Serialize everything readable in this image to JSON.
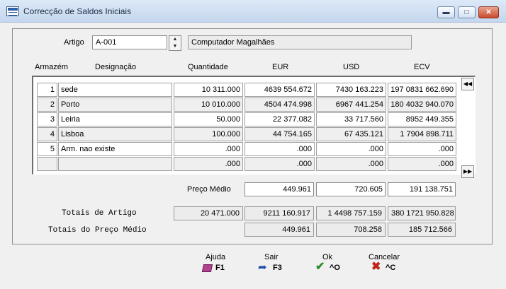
{
  "window": {
    "title": "Correcção de Saldos Iniciais"
  },
  "artigo": {
    "label": "Artigo",
    "code": "A-001",
    "description": "Computador Magalhães"
  },
  "columns": [
    "Armazém",
    "Designação",
    "Quantidade",
    "EUR",
    "USD",
    "ECV"
  ],
  "rows": [
    {
      "n": "1",
      "desig": "sede",
      "qty": "10 311.000",
      "eur": "4639 554.672",
      "usd": "7430 163.223",
      "ecv": "197 0831 662.690"
    },
    {
      "n": "2",
      "desig": "Porto",
      "qty": "10 010.000",
      "eur": "4504 474.998",
      "usd": "6967 441.254",
      "ecv": "180 4032 940.070"
    },
    {
      "n": "3",
      "desig": "Leiria",
      "qty": "50.000",
      "eur": "22 377.082",
      "usd": "33 717.560",
      "ecv": "8952 449.355"
    },
    {
      "n": "4",
      "desig": "Lisboa",
      "qty": "100.000",
      "eur": "44 754.165",
      "usd": "67 435.121",
      "ecv": "1 7904 898.711"
    },
    {
      "n": "5",
      "desig": "Arm. nao existe",
      "qty": ".000",
      "eur": ".000",
      "usd": ".000",
      "ecv": ".000"
    },
    {
      "n": "",
      "desig": "",
      "qty": ".000",
      "eur": ".000",
      "usd": ".000",
      "ecv": ".000"
    }
  ],
  "preco_medio": {
    "label": "Preço Médio",
    "eur": "449.961",
    "usd": "720.605",
    "ecv": "191 138.751"
  },
  "totais_artigo": {
    "label": "Totais de Artigo",
    "qty": "20 471.000",
    "eur": "9211 160.917",
    "usd": "1 4498 757.159",
    "ecv": "380 1721 950.828"
  },
  "totais_preco": {
    "label": "Totais do Preço Médio",
    "eur": "449.961",
    "usd": "708.258",
    "ecv": "185 712.566"
  },
  "buttons": [
    {
      "label": "Ajuda",
      "key": "F1"
    },
    {
      "label": "Sair",
      "key": "F3"
    },
    {
      "label": "Ok",
      "key": "^O"
    },
    {
      "label": "Cancelar",
      "key": "^C"
    }
  ],
  "colors": {
    "ok": "#2e8b2e",
    "cancel": "#c0241c",
    "help": "#b0428f",
    "exit": "#1e4fa8"
  }
}
